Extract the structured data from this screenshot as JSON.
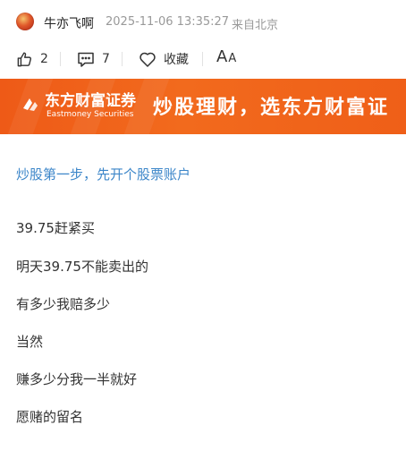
{
  "post": {
    "author": "牛亦飞啊",
    "timestamp": "2025-11-06 13:35:27",
    "source": "来自北京"
  },
  "actions": {
    "like_icon": "thumbs-up-icon",
    "like_count": "2",
    "comment_icon": "comment-icon",
    "comment_count": "7",
    "favorite_icon": "heart-icon",
    "favorite_label": "收藏",
    "font_size_large": "A",
    "font_size_small": "A"
  },
  "banner": {
    "logo_cn": "东方财富证券",
    "logo_en": "Eastmoney Securities",
    "slogan": "炒股理财，选东方财富证",
    "background_color": "#f0621b"
  },
  "content": {
    "promo_link": "炒股第一步，先开个股票账户",
    "link_color": "#3c86c9",
    "paragraphs": [
      "39.75赶紧买",
      "明天39.75不能卖出的",
      "有多少我赔多少",
      "当然",
      "赚多少分我一半就好",
      "愿赌的留名"
    ]
  }
}
